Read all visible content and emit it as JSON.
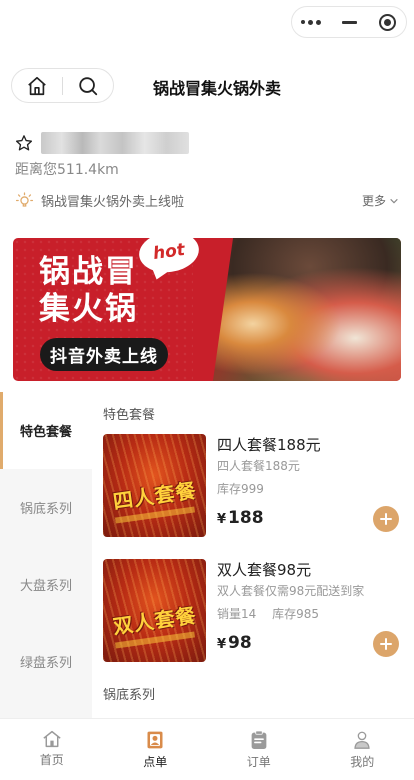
{
  "colors": {
    "accent": "#dca56a",
    "banner_red": "#c81f2a",
    "tab_active": "#222222"
  },
  "capsule": {
    "menu_icon": "more-dots-icon",
    "minimize_icon": "minimize-icon",
    "close_icon": "target-ring-icon"
  },
  "navbar": {
    "home_icon": "home-icon",
    "search_icon": "search-icon",
    "title": "锅战冒集火锅外卖"
  },
  "store": {
    "name_blurred": true,
    "distance": "距离您511.4km"
  },
  "notice": {
    "text": "锅战冒集火锅外卖上线啦",
    "more_label": "更多"
  },
  "banner": {
    "title_line1": "锅战冒",
    "title_line2": "集火锅",
    "tagline": "抖音外卖上线",
    "hot_badge": "hot"
  },
  "categories": [
    "特色套餐",
    "锅底系列",
    "大盘系列",
    "绿盘系列"
  ],
  "active_category": 0,
  "sections": [
    {
      "title": "特色套餐",
      "items": [
        {
          "name": "四人套餐188元",
          "desc": "四人套餐188元",
          "meta": "库存999",
          "price_symbol": "¥",
          "price": "188",
          "thumb_label": "四人套餐"
        },
        {
          "name": "双人套餐98元",
          "desc": "双人套餐仅需98元配送到家",
          "meta": "销量14　 库存985",
          "price_symbol": "¥",
          "price": "98",
          "thumb_label": "双人套餐"
        }
      ]
    },
    {
      "title": "锅底系列",
      "items": []
    }
  ],
  "tabbar": [
    {
      "label": "首页",
      "icon": "home-icon"
    },
    {
      "label": "点单",
      "icon": "order-food-icon"
    },
    {
      "label": "订单",
      "icon": "clipboard-icon"
    },
    {
      "label": "我的",
      "icon": "user-icon"
    }
  ],
  "active_tab": 1
}
